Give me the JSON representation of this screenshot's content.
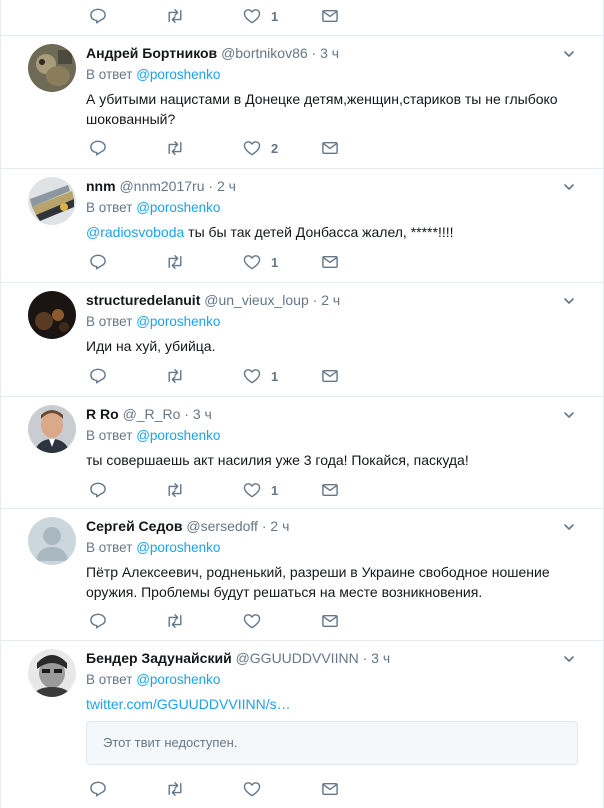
{
  "reply_prefix": "В ответ",
  "top_bar": {
    "like_count": "1"
  },
  "tweets": [
    {
      "name": "Андрей Бортников",
      "handle": "@bortnikov86",
      "time": "3 ч",
      "reply_to": "@poroshenko",
      "text_lines": [
        "А убитыми нацистами в Донецке детям,женщин,стариков ты не глыбоко",
        "шокованный?"
      ],
      "like_count": "2"
    },
    {
      "name": "nnm",
      "handle": "@nnm2017ru",
      "time": "2 ч",
      "reply_to": "@poroshenko",
      "mention": "@radiosvoboda",
      "text": " ты бы так детей Донбасса жалел, *****!!!!",
      "like_count": "1"
    },
    {
      "name": "structuredelanuit",
      "handle": "@un_vieux_loup",
      "time": "2 ч",
      "reply_to": "@poroshenko",
      "text": "Иди на хуй, убийца.",
      "like_count": "1"
    },
    {
      "name": "R Ro",
      "handle": "@_R_Ro",
      "time": "3 ч",
      "reply_to": "@poroshenko",
      "text": "ты совершаешь акт насилия уже 3 года! Покайся, паскуда!",
      "like_count": "1"
    },
    {
      "name": "Сергей Седов",
      "handle": "@sersedoff",
      "time": "2 ч",
      "reply_to": "@poroshenko",
      "text_lines": [
        "Пётр Алексеевич, родненький, разреши в Украине свободное ношение",
        "оружия.  Проблемы будут решаться на месте возникновения."
      ],
      "like_count": ""
    },
    {
      "name": "Бендер Задунайский",
      "handle": "@GGUUDDVVIINN",
      "time": "3 ч",
      "reply_to": "@poroshenko",
      "link": "twitter.com/GGUUDDVVIINN/s…",
      "unavailable": "Этот твит недоступен.",
      "like_count": ""
    }
  ],
  "icons": [
    "reply-icon",
    "retweet-icon",
    "like-icon",
    "direct-message-icon",
    "caret-down-icon"
  ],
  "colors": {
    "accent": "#1da1f2",
    "muted": "#657786",
    "border": "#e6ecf0",
    "text": "#14171a"
  }
}
